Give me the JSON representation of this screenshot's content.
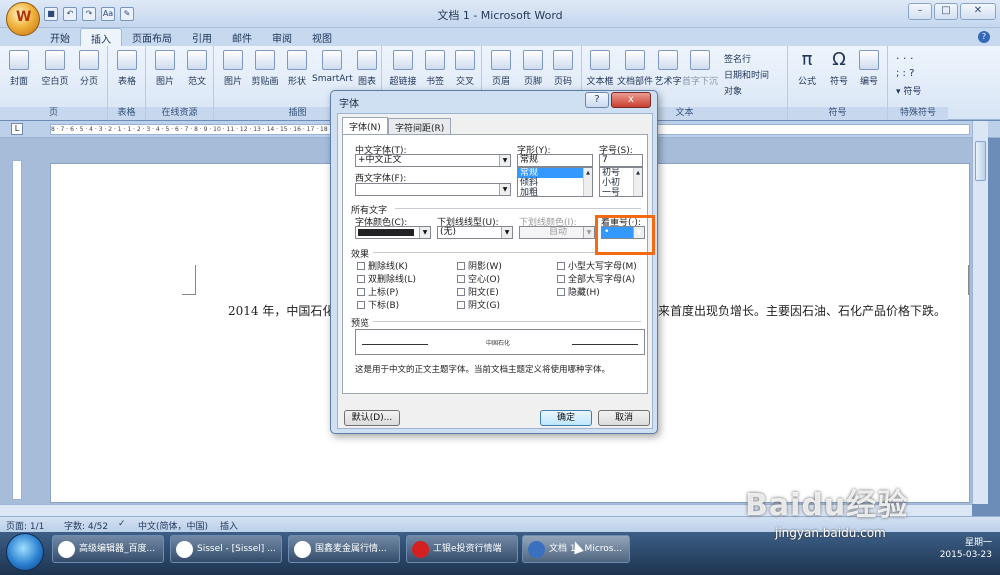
{
  "window": {
    "title": "文档 1 - Microsoft Word",
    "office_button": "W"
  },
  "qat": {
    "items": [
      "save",
      "undo",
      "redo",
      "Aa",
      "format"
    ]
  },
  "tabs": [
    "开始",
    "插入",
    "页面布局",
    "引用",
    "邮件",
    "审阅",
    "视图"
  ],
  "ribbon": {
    "groups": [
      {
        "label": "页",
        "buttons": [
          "封面",
          "空白页",
          "分页"
        ]
      },
      {
        "label": "表格",
        "buttons": [
          "表格"
        ]
      },
      {
        "label": "在线资源",
        "buttons": [
          "图片",
          "范文"
        ]
      },
      {
        "label": "插图",
        "buttons": [
          "图片",
          "剪贴画",
          "形状",
          "SmartArt",
          "图表"
        ]
      },
      {
        "label": "",
        "buttons": [
          "超链接",
          "书签",
          "交叉"
        ]
      },
      {
        "label": "",
        "buttons": [
          "页眉",
          "页脚",
          "页码"
        ]
      },
      {
        "label": "文本",
        "buttons": [
          "文本框",
          "文档部件",
          "艺术字",
          "首字下沉"
        ]
      },
      {
        "label": "符号",
        "buttons": [
          "公式",
          "符号",
          "编号"
        ]
      },
      {
        "label": "特殊符号",
        "buttons": [
          "符号"
        ]
      }
    ],
    "text_side": [
      "签名行",
      "日期和时间",
      "对象"
    ]
  },
  "document": {
    "line_left": "2014 年，中国石化",
    "line_right": "来首度出现负增长。主要因石油、石化产品价格下跌。"
  },
  "dialog": {
    "title": "字体",
    "help": "?",
    "close": "x",
    "tabs": [
      "字体(N)",
      "字符间距(R)"
    ],
    "cn_font_label": "中文字体(T):",
    "cn_font_value": "+中文正文",
    "west_font_label": "西文字体(F):",
    "west_font_value": "",
    "style_label": "字形(Y):",
    "style_value": "常规",
    "style_list": [
      "常规",
      "倾斜",
      "加粗"
    ],
    "size_label": "字号(S):",
    "size_value": "7",
    "size_list": [
      "初号",
      "小初",
      "一号"
    ],
    "all_text_label": "所有文字",
    "color_label": "字体颜色(C):",
    "underline_label": "下划线线型(U):",
    "underline_value": "(无)",
    "ucolor_label": "下划线颜色(I):",
    "ucolor_value": "自动",
    "emphasis_label": "着重号(·):",
    "emphasis_value": "•",
    "effects_label": "效果",
    "effects_col1": [
      "删除线(K)",
      "双删除线(L)",
      "上标(P)",
      "下标(B)"
    ],
    "effects_col2": [
      "阴影(W)",
      "空心(O)",
      "阳文(E)",
      "阴文(G)"
    ],
    "effects_col3": [
      "小型大写字母(M)",
      "全部大写字母(A)",
      "隐藏(H)"
    ],
    "preview_label": "预览",
    "preview_text": "中国石化",
    "description": "这是用于中文的正文主题字体。当前文档主题定义将使用哪种字体。",
    "default_btn": "默认(D)...",
    "ok_btn": "确定",
    "cancel_btn": "取消"
  },
  "status": {
    "page": "页面: 1/1",
    "words": "字数: 4/52",
    "lang": "中文(简体，中国)",
    "mode": "插入"
  },
  "taskbar": {
    "items": [
      "高级编辑器_百度...",
      "Sissel - [Sissel] ...",
      "国鑫麦金属行情...",
      "工银e投资行情端",
      "文档 1 - Micros..."
    ],
    "clock_time": "星期一",
    "clock_date": "2015-03-23"
  },
  "watermark": {
    "text": "Baidu经验",
    "url": "jingyan.baidu.com"
  }
}
